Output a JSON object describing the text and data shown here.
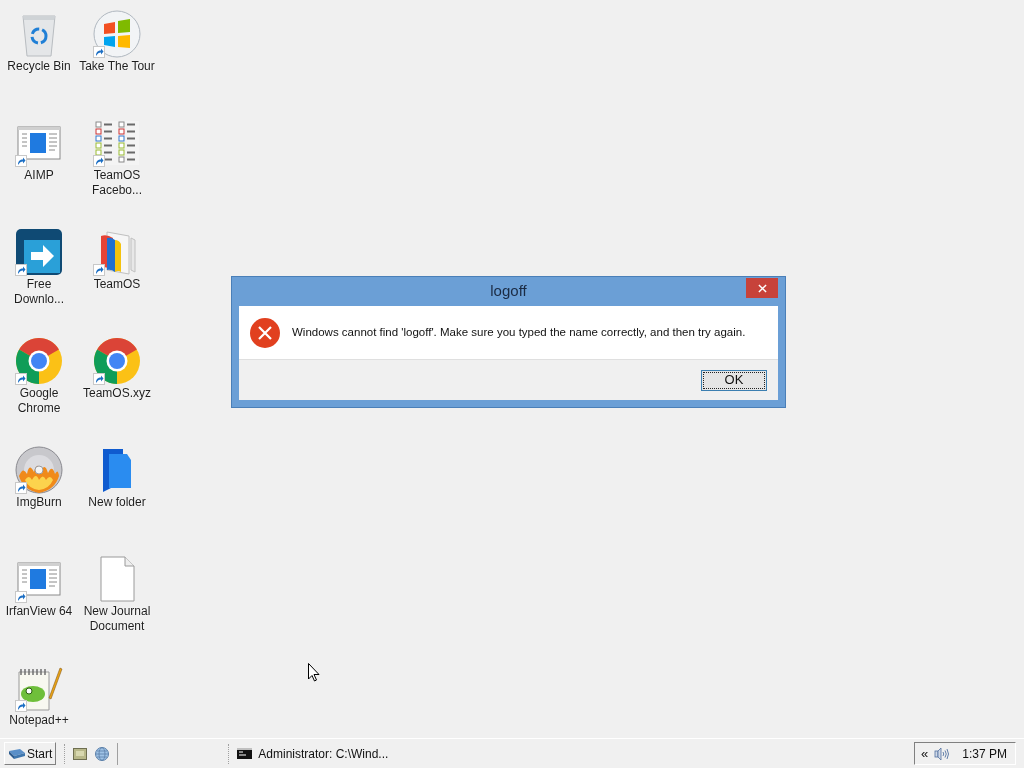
{
  "desktop": {
    "icons": [
      {
        "label": "Recycle Bin",
        "kind": "recycle-bin",
        "shortcut": false
      },
      {
        "label": "Take The Tour",
        "kind": "windows-logo",
        "shortcut": true
      },
      {
        "label": "AIMP",
        "kind": "app-window",
        "shortcut": true
      },
      {
        "label": "TeamOS Facebo...",
        "kind": "checklist",
        "shortcut": true
      },
      {
        "label": "Free Downlo...",
        "kind": "download-arrow",
        "shortcut": true
      },
      {
        "label": "TeamOS",
        "kind": "book",
        "shortcut": true
      },
      {
        "label": "Google Chrome",
        "kind": "chrome",
        "shortcut": true
      },
      {
        "label": "TeamOS.xyz",
        "kind": "chrome",
        "shortcut": true
      },
      {
        "label": "ImgBurn",
        "kind": "disc",
        "shortcut": true
      },
      {
        "label": "New folder",
        "kind": "folder",
        "shortcut": false
      },
      {
        "label": "IrfanView 64",
        "kind": "app-window",
        "shortcut": true
      },
      {
        "label": "New Journal Document",
        "kind": "document",
        "shortcut": false
      },
      {
        "label": "Notepad++",
        "kind": "notepad",
        "shortcut": true
      }
    ]
  },
  "dialog": {
    "title": "logoff",
    "message": "Windows cannot find 'logoff'. Make sure you typed the name correctly, and then try again.",
    "buttons": [
      {
        "label": "OK",
        "focused": true
      }
    ]
  },
  "taskbar": {
    "start": "Start",
    "tasks": [
      {
        "label": "Administrator: C:\\Wind...",
        "selected": false
      }
    ],
    "tray": {
      "expand": "«",
      "clock": "1:37 PM"
    }
  }
}
